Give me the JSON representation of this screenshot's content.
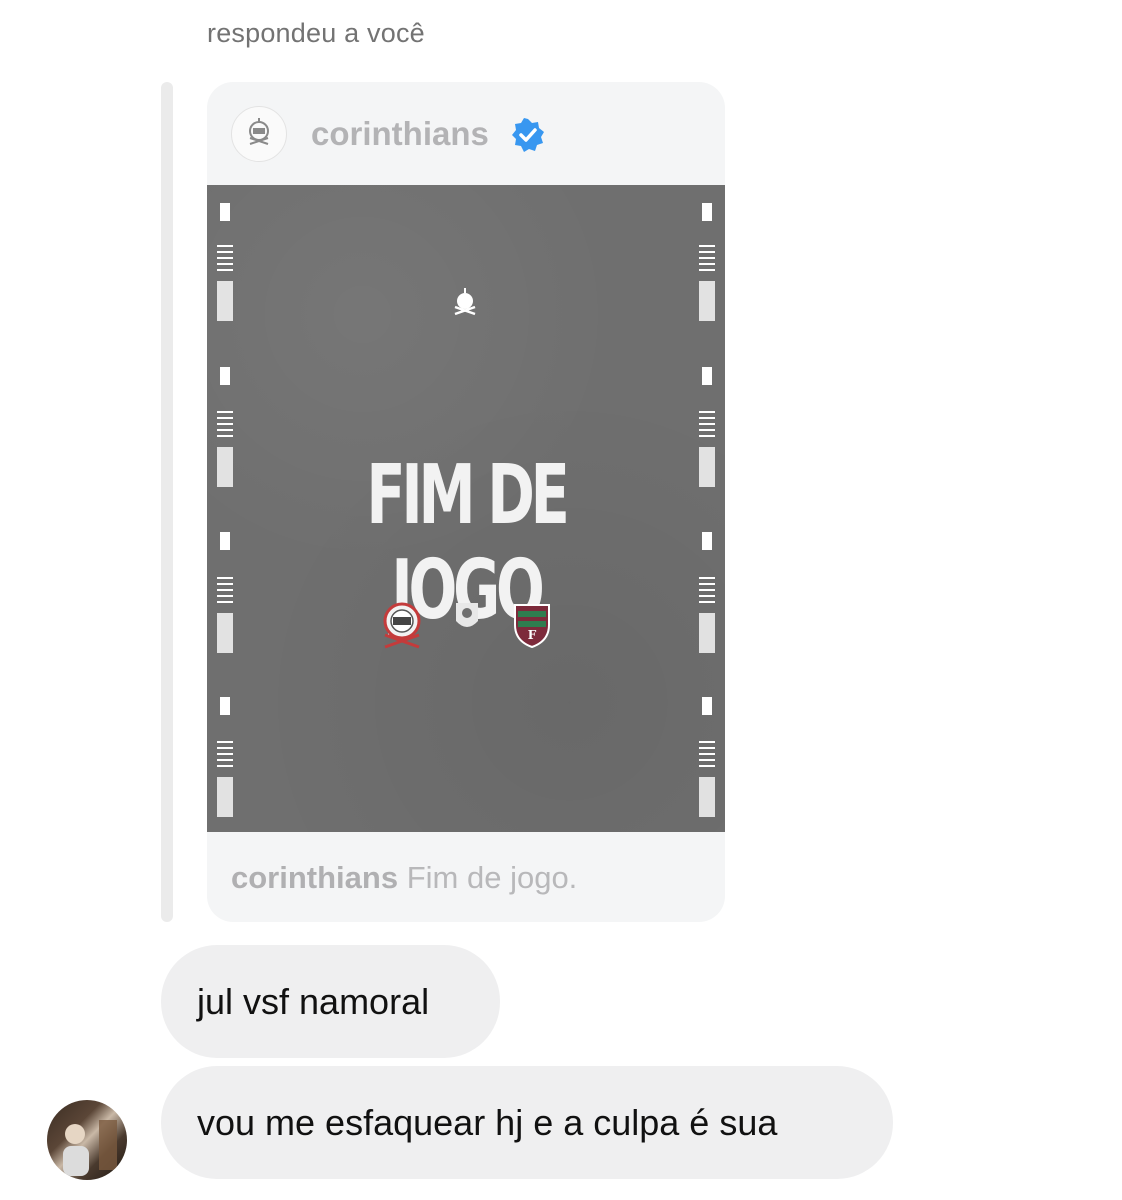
{
  "thread": {
    "reply_label": "respondeu a você"
  },
  "shared_post": {
    "username": "corinthians",
    "verified": true,
    "verified_color": "#3897f0",
    "image": {
      "headline": "FIM DE JOGO",
      "background_color": "#6f6f6f",
      "logos": [
        "corinthians-crest",
        "brasileirao-logo",
        "fluminense-crest"
      ]
    },
    "caption_user": "corinthians",
    "caption_text": "Fim de jogo."
  },
  "messages": [
    {
      "text": "jul vsf namoral"
    },
    {
      "text": "vou me esfaquear hj e a culpa é sua"
    }
  ],
  "colors": {
    "bubble_background": "#efeff0",
    "card_background": "#f4f5f6",
    "muted_text": "#737373"
  }
}
